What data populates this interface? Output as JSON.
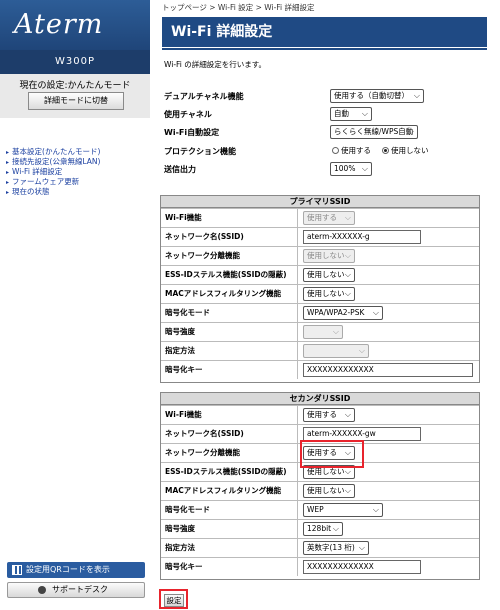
{
  "sidebar": {
    "logo": "Aterm",
    "model": "W300P",
    "current_mode": "現在の設定:かんたんモード",
    "mode_button": "詳細モードに切替",
    "nav": [
      "基本設定(かんたんモード)",
      "接続先設定(公衆無線LAN)",
      "Wi-Fi 詳細設定",
      "ファームウェア更新",
      "現在の状態"
    ],
    "qr_button": "設定用QRコードを表示",
    "support_button": "サポートデスク"
  },
  "breadcrumb": "トップページ > Wi-Fi 設定 > Wi-Fi 詳細設定",
  "title": "Wi-Fi 詳細設定",
  "description": "Wi-Fi の詳細設定を行います。",
  "general": {
    "dual_channel_label": "デュアルチャネル機能",
    "dual_channel_value": "使用する（自動切替）",
    "channel_label": "使用チャネル",
    "channel_value": "自動",
    "auto_setup_label": "Wi-Fi自動設定",
    "auto_setup_value": "らくらく無線/WPS自動",
    "protection_label": "プロテクション機能",
    "protection_option_use": "使用する",
    "protection_option_off": "使用しない",
    "protection_selected": "使用しない",
    "tx_power_label": "送信出力",
    "tx_power_value": "100%"
  },
  "primary": {
    "header": "プライマリSSID",
    "rows": {
      "wifi_label": "Wi-Fi機能",
      "wifi_value": "使用する",
      "ssid_label": "ネットワーク名(SSID)",
      "ssid_value": "aterm-XXXXXX-g",
      "separation_label": "ネットワーク分離機能",
      "separation_value": "使用しない",
      "stealth_label": "ESS-IDステルス機能(SSIDの隠蔽)",
      "stealth_value": "使用しない",
      "mac_label": "MACアドレスフィルタリング機能",
      "mac_value": "使用しない",
      "enc_mode_label": "暗号化モード",
      "enc_mode_value": "WPA/WPA2-PSK",
      "enc_strength_label": "暗号強度",
      "enc_strength_value": "",
      "method_label": "指定方法",
      "method_value": "",
      "key_label": "暗号化キー",
      "key_value": "XXXXXXXXXXXXX"
    }
  },
  "secondary": {
    "header": "セカンダリSSID",
    "rows": {
      "wifi_label": "Wi-Fi機能",
      "wifi_value": "使用する",
      "ssid_label": "ネットワーク名(SSID)",
      "ssid_value": "aterm-XXXXXX-gw",
      "separation_label": "ネットワーク分離機能",
      "separation_value": "使用する",
      "stealth_label": "ESS-IDステルス機能(SSIDの隠蔽)",
      "stealth_value": "使用しない",
      "mac_label": "MACアドレスフィルタリング機能",
      "mac_value": "使用しない",
      "enc_mode_label": "暗号化モード",
      "enc_mode_value": "WEP",
      "enc_strength_label": "暗号強度",
      "enc_strength_value": "128bit",
      "method_label": "指定方法",
      "method_value": "英数字(13 桁)",
      "key_label": "暗号化キー",
      "key_value": "XXXXXXXXXXXXX"
    }
  },
  "submit_button": "設定",
  "colors": {
    "header_blue": "#1f4a84",
    "highlight_red": "#e8242d"
  }
}
